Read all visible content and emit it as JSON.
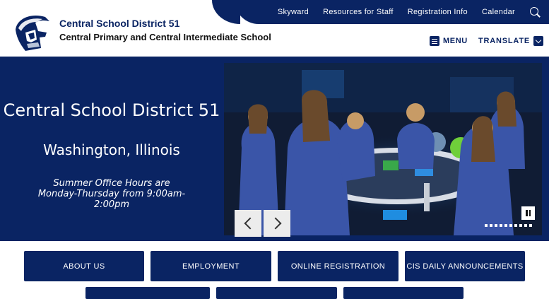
{
  "topnav": {
    "links": [
      "Skyward",
      "Resources for Staff",
      "Registration Info",
      "Calendar"
    ],
    "search_icon": "search-icon"
  },
  "header": {
    "district_name": "Central School District 51",
    "school_name": "Central Primary and Central Intermediate School",
    "menu_label": "MENU",
    "translate_label": "TRANSLATE"
  },
  "hero": {
    "title": "Central School District 51",
    "subtitle": "Washington, Illinois",
    "hours": "Summer Office Hours are Monday-Thursday from 9:00am-2:00pm",
    "slide_count": 10
  },
  "quick_links": [
    "ABOUT US",
    "EMPLOYMENT",
    "ONLINE REGISTRATION",
    "CIS DAILY ANNOUNCEMENTS"
  ],
  "colors": {
    "brand_navy": "#0a2463",
    "white": "#ffffff"
  }
}
